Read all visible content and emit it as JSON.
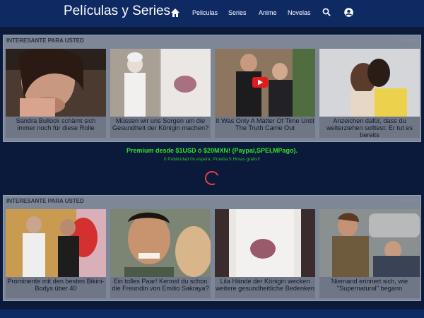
{
  "nav": {
    "brand": "Películas y Series",
    "links": [
      "Peliculas",
      "Series",
      "Anime",
      "Novelas"
    ],
    "icons": [
      "home-icon",
      "search-icon",
      "user-icon"
    ]
  },
  "sections": [
    {
      "title": "INTERESANTE PARA USTED",
      "cards": [
        {
          "caption": "Sandra Bullock schämt sich immer noch für diese Rolle"
        },
        {
          "caption": "Müssen wir uns Sorgen um die Gesundheit der Königin machen?"
        },
        {
          "caption": "It Was Only A Matter Of Time Until The Truth Came Out"
        },
        {
          "caption": "Anzeichen dafür, dass du weiterziehen solltest: Er tut es bereits"
        }
      ]
    },
    {
      "title": "INTERESANTE PARA USTED",
      "cards": [
        {
          "caption": "Prominente mit den besten Bikini-Bodys über 40"
        },
        {
          "caption": "Ein tolles Paar! Kennst du schon die Freundin von Emilio Sakraya?"
        },
        {
          "caption": "Lila Hände der Königin wecken weitere gesundheitliche Bedenken"
        },
        {
          "caption": "Niemand erinnert sich, wie \"Supernatural\" begann"
        }
      ]
    }
  ],
  "premium": "Premium desde $1USD ó $20MXN! (Paypal,SPEI,MPago).",
  "promo": "0 Publicidad 0s espera. Prueba 5 Horas gratis!!",
  "colors": {
    "navbar": "#0f2a63",
    "background": "#0b1a3a",
    "premium": "#33e02a",
    "spinner": "#e8433a"
  }
}
